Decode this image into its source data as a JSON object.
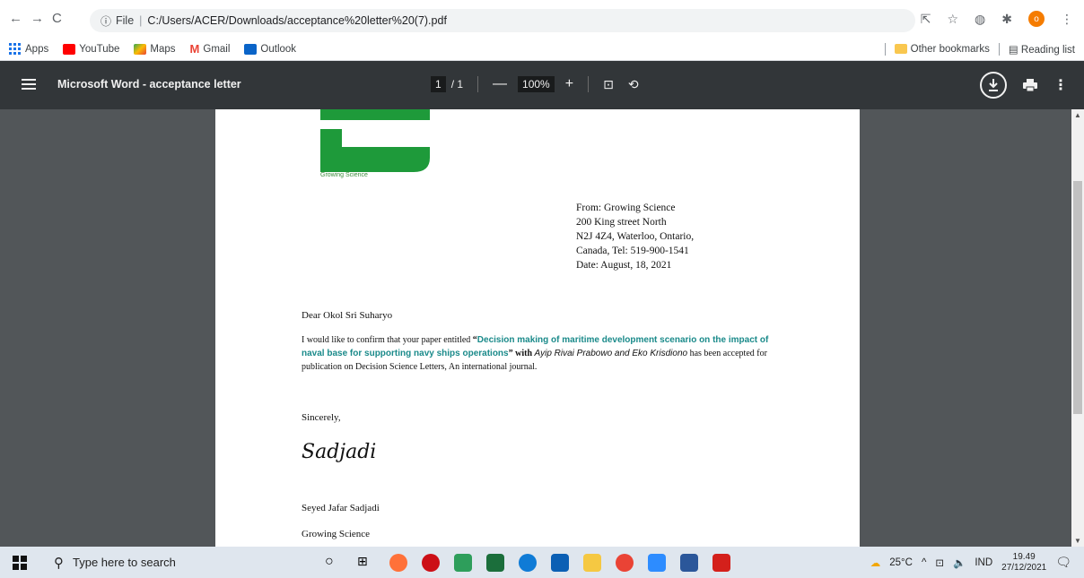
{
  "browser": {
    "omnibox_prefix": "File",
    "url": "C:/Users/ACER/Downloads/acceptance%20letter%20(7).pdf",
    "profile_initial": "o"
  },
  "bookmarks": {
    "items": [
      "Apps",
      "YouTube",
      "Maps",
      "Gmail",
      "Outlook"
    ],
    "other": "Other bookmarks",
    "reading_list": "Reading list"
  },
  "pdf": {
    "title": "Microsoft Word - acceptance letter",
    "page_current": "1",
    "page_total": "/ 1",
    "zoom": "100%"
  },
  "letter": {
    "logo_text": "Growing Science",
    "from_lines": [
      "From: Growing Science",
      "200 King street North",
      "N2J 4Z4, Waterloo, Ontario,",
      "Canada, Tel: 519-900-1541",
      "Date: August, 18, 2021"
    ],
    "greeting": "Dear Okol Sri Suharyo",
    "body_pre": "I would like to confirm that your paper entitled ",
    "open_quote": "“",
    "paper_title": "Decision making of maritime development scenario on the impact of naval base for supporting navy ships operations",
    "close_quote_with": "” with ",
    "authors": "Ayip Rivai Prabowo and Eko Krisdiono",
    "body_post": "  has been accepted for publication on Decision Science Letters, An international journal.",
    "closing": "Sincerely,",
    "signature": "Sadjadi",
    "signer_name": "Seyed Jafar Sadjadi",
    "signer_org": "Growing Science"
  },
  "taskbar": {
    "search_placeholder": "Type here to search",
    "weather": "25°C",
    "language": "IND",
    "time": "19.49",
    "date": "27/12/2021"
  },
  "colors": {
    "logo_green": "#1e9a3a",
    "title_teal": "#1a8a8a",
    "toolbar": "#323639",
    "viewer_bg": "#525659"
  }
}
